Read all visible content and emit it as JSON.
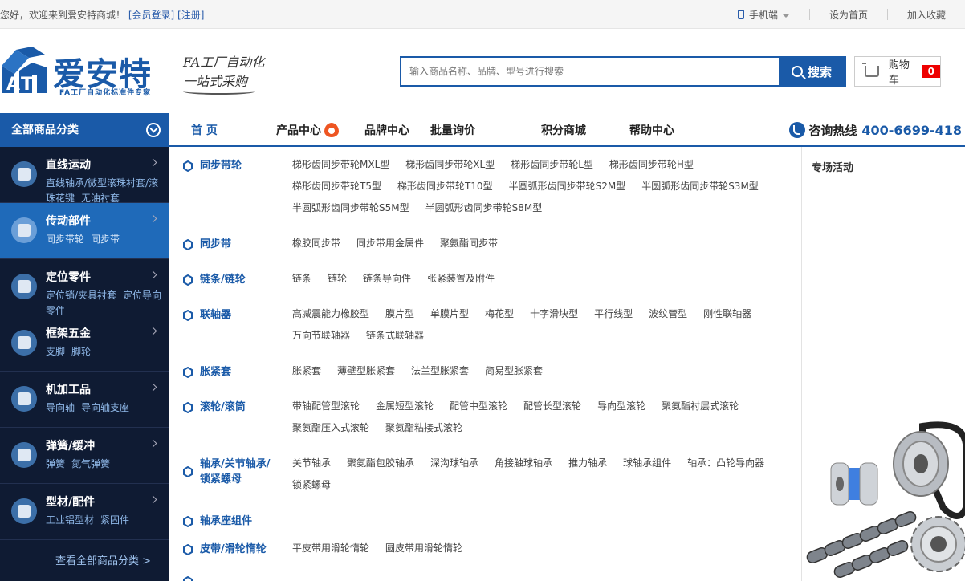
{
  "topbar": {
    "welcome": "您好，欢迎来到爱安特商城！",
    "login": "[会员登录]",
    "register": "[注册]",
    "mobile": "手机端",
    "set_home": "设为首页",
    "favorite": "加入收藏"
  },
  "header": {
    "logo_name": "爱安特",
    "logo_sub": "FA工厂自动化标准件专家",
    "slogan_line1": "FA工厂自动化",
    "slogan_line2": "一站式采购",
    "search_placeholder": "输入商品名称、品牌、型号进行搜索",
    "search_button": "搜索",
    "cart_label": "购物车",
    "cart_count": "0"
  },
  "nav": {
    "all_categories": "全部商品分类",
    "links": [
      "首 页",
      "产品中心",
      "品牌中心",
      "批量询价",
      "积分商城",
      "帮助中心"
    ],
    "hotline_label": "咨询热线",
    "hotline_number": "400-6699-418"
  },
  "sidebar": {
    "categories": [
      {
        "title": "直线运动",
        "subs": [
          "直线轴承/微型滚珠衬套/滚珠花键",
          "无油衬套"
        ]
      },
      {
        "title": "传动部件",
        "subs": [
          "同步带轮",
          "同步带"
        ]
      },
      {
        "title": "定位零件",
        "subs": [
          "定位销/夹具衬套",
          "定位导向零件"
        ]
      },
      {
        "title": "框架五金",
        "subs": [
          "支脚",
          "脚轮"
        ]
      },
      {
        "title": "机加工品",
        "subs": [
          "导向轴",
          "导向轴支座"
        ]
      },
      {
        "title": "弹簧/缓冲",
        "subs": [
          "弹簧",
          "氮气弹簧"
        ]
      },
      {
        "title": "型材/配件",
        "subs": [
          "工业铝型材",
          "紧固件"
        ]
      }
    ],
    "view_all": "查看全部商品分类 >"
  },
  "menu": {
    "rows": [
      {
        "title": "同步带轮",
        "items": [
          "梯形齿同步带轮MXL型",
          "梯形齿同步带轮XL型",
          "梯形齿同步带轮L型",
          "梯形齿同步带轮H型",
          "梯形齿同步带轮T5型",
          "梯形齿同步带轮T10型",
          "半圆弧形齿同步带轮S2M型",
          "半圆弧形齿同步带轮S3M型",
          "半圆弧形齿同步带轮S5M型",
          "半圆弧形齿同步带轮S8M型"
        ]
      },
      {
        "title": "同步带",
        "items": [
          "橡胶同步带",
          "同步带用金属件",
          "聚氨酯同步带"
        ]
      },
      {
        "title": "链条/链轮",
        "items": [
          "链条",
          "链轮",
          "链条导向件",
          "张紧装置及附件"
        ]
      },
      {
        "title": "联轴器",
        "items": [
          "高减震能力橡胶型",
          "膜片型",
          "单膜片型",
          "梅花型",
          "十字滑块型",
          "平行线型",
          "波纹管型",
          "刚性联轴器",
          "万向节联轴器",
          "链条式联轴器"
        ]
      },
      {
        "title": "胀紧套",
        "items": [
          "胀紧套",
          "薄壁型胀紧套",
          "法兰型胀紧套",
          "简易型胀紧套"
        ]
      },
      {
        "title": "滚轮/滚筒",
        "items": [
          "带轴配管型滚轮",
          "金属短型滚轮",
          "配管中型滚轮",
          "配管长型滚轮",
          "导向型滚轮",
          "聚氨酯衬层式滚轮",
          "聚氨酯压入式滚轮",
          "聚氨酯粘接式滚轮"
        ]
      },
      {
        "title": "轴承/关节轴承/锁紧螺母",
        "items": [
          "关节轴承",
          "聚氨酯包胶轴承",
          "深沟球轴承",
          "角接触球轴承",
          "推力轴承",
          "球轴承组件",
          "轴承：凸轮导向器",
          "锁紧螺母"
        ]
      },
      {
        "title": "轴承座组件",
        "items": []
      },
      {
        "title": "皮带/滑轮惰轮",
        "items": [
          "平皮带用滑轮惰轮",
          "圆皮带用滑轮惰轮"
        ]
      }
    ]
  },
  "right_panel": {
    "title": "专场活动"
  },
  "colors": {
    "brand_blue": "#1a5aa8",
    "sidebar_bg": "#0f1b33",
    "active_cat": "#1f6ab9",
    "badge_red": "#e00000"
  }
}
